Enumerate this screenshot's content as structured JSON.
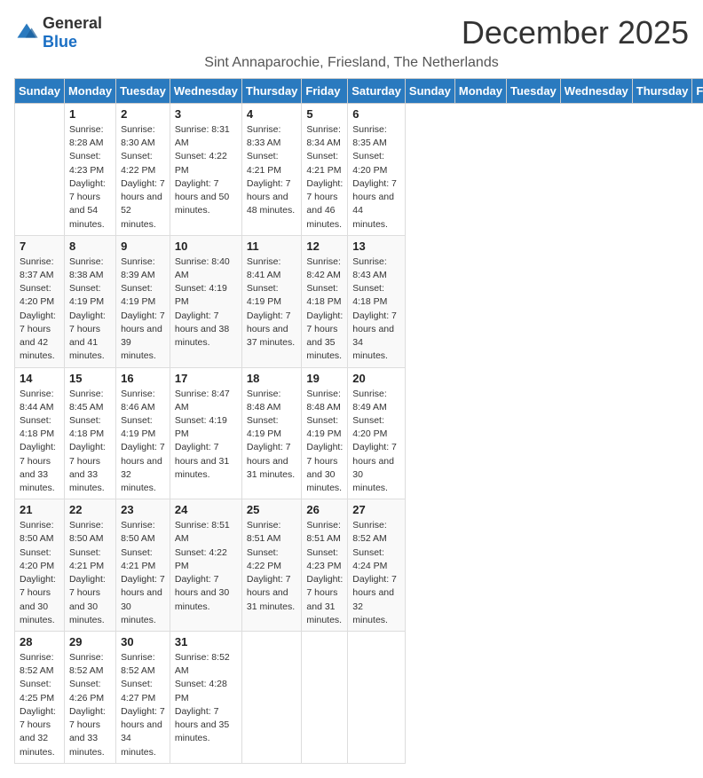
{
  "logo": {
    "general": "General",
    "blue": "Blue"
  },
  "title": "December 2025",
  "location": "Sint Annaparochie, Friesland, The Netherlands",
  "days_of_week": [
    "Sunday",
    "Monday",
    "Tuesday",
    "Wednesday",
    "Thursday",
    "Friday",
    "Saturday"
  ],
  "weeks": [
    [
      {
        "day": "",
        "sunrise": "",
        "sunset": "",
        "daylight": ""
      },
      {
        "day": "1",
        "sunrise": "Sunrise: 8:28 AM",
        "sunset": "Sunset: 4:23 PM",
        "daylight": "Daylight: 7 hours and 54 minutes."
      },
      {
        "day": "2",
        "sunrise": "Sunrise: 8:30 AM",
        "sunset": "Sunset: 4:22 PM",
        "daylight": "Daylight: 7 hours and 52 minutes."
      },
      {
        "day": "3",
        "sunrise": "Sunrise: 8:31 AM",
        "sunset": "Sunset: 4:22 PM",
        "daylight": "Daylight: 7 hours and 50 minutes."
      },
      {
        "day": "4",
        "sunrise": "Sunrise: 8:33 AM",
        "sunset": "Sunset: 4:21 PM",
        "daylight": "Daylight: 7 hours and 48 minutes."
      },
      {
        "day": "5",
        "sunrise": "Sunrise: 8:34 AM",
        "sunset": "Sunset: 4:21 PM",
        "daylight": "Daylight: 7 hours and 46 minutes."
      },
      {
        "day": "6",
        "sunrise": "Sunrise: 8:35 AM",
        "sunset": "Sunset: 4:20 PM",
        "daylight": "Daylight: 7 hours and 44 minutes."
      }
    ],
    [
      {
        "day": "7",
        "sunrise": "Sunrise: 8:37 AM",
        "sunset": "Sunset: 4:20 PM",
        "daylight": "Daylight: 7 hours and 42 minutes."
      },
      {
        "day": "8",
        "sunrise": "Sunrise: 8:38 AM",
        "sunset": "Sunset: 4:19 PM",
        "daylight": "Daylight: 7 hours and 41 minutes."
      },
      {
        "day": "9",
        "sunrise": "Sunrise: 8:39 AM",
        "sunset": "Sunset: 4:19 PM",
        "daylight": "Daylight: 7 hours and 39 minutes."
      },
      {
        "day": "10",
        "sunrise": "Sunrise: 8:40 AM",
        "sunset": "Sunset: 4:19 PM",
        "daylight": "Daylight: 7 hours and 38 minutes."
      },
      {
        "day": "11",
        "sunrise": "Sunrise: 8:41 AM",
        "sunset": "Sunset: 4:19 PM",
        "daylight": "Daylight: 7 hours and 37 minutes."
      },
      {
        "day": "12",
        "sunrise": "Sunrise: 8:42 AM",
        "sunset": "Sunset: 4:18 PM",
        "daylight": "Daylight: 7 hours and 35 minutes."
      },
      {
        "day": "13",
        "sunrise": "Sunrise: 8:43 AM",
        "sunset": "Sunset: 4:18 PM",
        "daylight": "Daylight: 7 hours and 34 minutes."
      }
    ],
    [
      {
        "day": "14",
        "sunrise": "Sunrise: 8:44 AM",
        "sunset": "Sunset: 4:18 PM",
        "daylight": "Daylight: 7 hours and 33 minutes."
      },
      {
        "day": "15",
        "sunrise": "Sunrise: 8:45 AM",
        "sunset": "Sunset: 4:18 PM",
        "daylight": "Daylight: 7 hours and 33 minutes."
      },
      {
        "day": "16",
        "sunrise": "Sunrise: 8:46 AM",
        "sunset": "Sunset: 4:19 PM",
        "daylight": "Daylight: 7 hours and 32 minutes."
      },
      {
        "day": "17",
        "sunrise": "Sunrise: 8:47 AM",
        "sunset": "Sunset: 4:19 PM",
        "daylight": "Daylight: 7 hours and 31 minutes."
      },
      {
        "day": "18",
        "sunrise": "Sunrise: 8:48 AM",
        "sunset": "Sunset: 4:19 PM",
        "daylight": "Daylight: 7 hours and 31 minutes."
      },
      {
        "day": "19",
        "sunrise": "Sunrise: 8:48 AM",
        "sunset": "Sunset: 4:19 PM",
        "daylight": "Daylight: 7 hours and 30 minutes."
      },
      {
        "day": "20",
        "sunrise": "Sunrise: 8:49 AM",
        "sunset": "Sunset: 4:20 PM",
        "daylight": "Daylight: 7 hours and 30 minutes."
      }
    ],
    [
      {
        "day": "21",
        "sunrise": "Sunrise: 8:50 AM",
        "sunset": "Sunset: 4:20 PM",
        "daylight": "Daylight: 7 hours and 30 minutes."
      },
      {
        "day": "22",
        "sunrise": "Sunrise: 8:50 AM",
        "sunset": "Sunset: 4:21 PM",
        "daylight": "Daylight: 7 hours and 30 minutes."
      },
      {
        "day": "23",
        "sunrise": "Sunrise: 8:50 AM",
        "sunset": "Sunset: 4:21 PM",
        "daylight": "Daylight: 7 hours and 30 minutes."
      },
      {
        "day": "24",
        "sunrise": "Sunrise: 8:51 AM",
        "sunset": "Sunset: 4:22 PM",
        "daylight": "Daylight: 7 hours and 30 minutes."
      },
      {
        "day": "25",
        "sunrise": "Sunrise: 8:51 AM",
        "sunset": "Sunset: 4:22 PM",
        "daylight": "Daylight: 7 hours and 31 minutes."
      },
      {
        "day": "26",
        "sunrise": "Sunrise: 8:51 AM",
        "sunset": "Sunset: 4:23 PM",
        "daylight": "Daylight: 7 hours and 31 minutes."
      },
      {
        "day": "27",
        "sunrise": "Sunrise: 8:52 AM",
        "sunset": "Sunset: 4:24 PM",
        "daylight": "Daylight: 7 hours and 32 minutes."
      }
    ],
    [
      {
        "day": "28",
        "sunrise": "Sunrise: 8:52 AM",
        "sunset": "Sunset: 4:25 PM",
        "daylight": "Daylight: 7 hours and 32 minutes."
      },
      {
        "day": "29",
        "sunrise": "Sunrise: 8:52 AM",
        "sunset": "Sunset: 4:26 PM",
        "daylight": "Daylight: 7 hours and 33 minutes."
      },
      {
        "day": "30",
        "sunrise": "Sunrise: 8:52 AM",
        "sunset": "Sunset: 4:27 PM",
        "daylight": "Daylight: 7 hours and 34 minutes."
      },
      {
        "day": "31",
        "sunrise": "Sunrise: 8:52 AM",
        "sunset": "Sunset: 4:28 PM",
        "daylight": "Daylight: 7 hours and 35 minutes."
      },
      {
        "day": "",
        "sunrise": "",
        "sunset": "",
        "daylight": ""
      },
      {
        "day": "",
        "sunrise": "",
        "sunset": "",
        "daylight": ""
      },
      {
        "day": "",
        "sunrise": "",
        "sunset": "",
        "daylight": ""
      }
    ]
  ]
}
